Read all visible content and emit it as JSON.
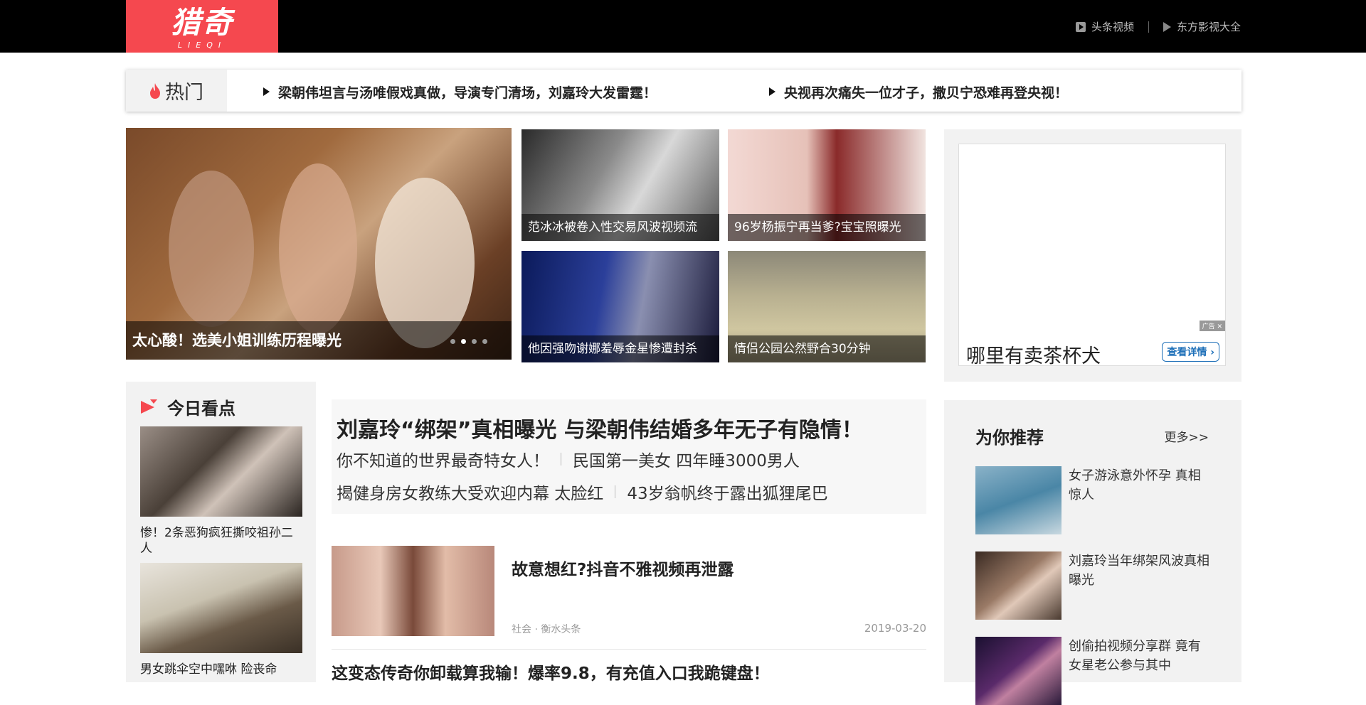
{
  "header": {
    "logo_text": "猎奇",
    "logo_sub": "LIEQI",
    "links": [
      {
        "label": "头条视频",
        "icon": "video-play-icon"
      },
      {
        "label": "东方影视大全",
        "icon": "play-triangle-icon"
      }
    ]
  },
  "hot": {
    "label": "热门",
    "items": [
      "梁朝伟坦言与汤唯假戏真做，导演专门清场，刘嘉玲大发雷霆！",
      "央视再次痛失一位才子，撒贝宁恐难再登央视！"
    ]
  },
  "slider": {
    "caption": "太心酸！选美小姐训练历程曝光",
    "active_index": 1,
    "count": 4
  },
  "thumbs": [
    {
      "caption": "范冰冰被卷入性交易风波视频流"
    },
    {
      "caption": "96岁杨振宁再当爹?宝宝照曝光"
    },
    {
      "caption": "他因强吻谢娜羞辱金星惨遭封杀"
    },
    {
      "caption": "情侣公园公然野合30分钟"
    }
  ],
  "ad": {
    "tag": "广告",
    "title": "哪里有卖茶杯犬",
    "button": "查看详情"
  },
  "today": {
    "heading": "今日看点",
    "items": [
      {
        "text": "惨！2条恶狗疯狂撕咬祖孙二人"
      },
      {
        "text": "男女跳伞空中嘿咻 险丧命"
      }
    ]
  },
  "featured": {
    "title": "刘嘉玲“绑架”真相曝光 与梁朝伟结婚多年无子有隐情！",
    "row1": [
      "你不知道的世界最奇特女人！",
      "民国第一美女 四年睡3000男人"
    ],
    "row2": [
      "揭健身房女教练大受欢迎内幕 太脸红",
      "43岁翁帆终于露出狐狸尾巴"
    ]
  },
  "news": [
    {
      "title": "故意想红?抖音不雅视频再泄露",
      "meta": "社会 · 衡水头条",
      "date": "2019-03-20"
    },
    {
      "title": "这变态传奇你卸载算我输！爆率9.8，有充值入口我跪键盘！"
    }
  ],
  "recommend": {
    "heading": "为你推荐",
    "more": "更多>>",
    "items": [
      {
        "text": "女子游泳意外怀孕 真相惊人"
      },
      {
        "text": "刘嘉玲当年绑架风波真相曝光"
      },
      {
        "text": "创偷拍视频分享群 竟有女星老公参与其中"
      }
    ]
  },
  "colors": {
    "brand_red": "#f5484f",
    "topbar": "#000000",
    "panel_gray": "#f2f2f2",
    "ad_blue": "#1d6fb8"
  }
}
